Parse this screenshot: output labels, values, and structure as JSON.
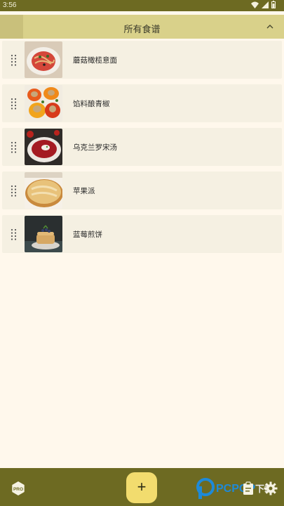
{
  "status": {
    "time": "3:56"
  },
  "header": {
    "title": "所有食谱"
  },
  "recipes": [
    {
      "name": "蘑菇橄榄意面"
    },
    {
      "name": "馅料酿青椒"
    },
    {
      "name": "乌克兰罗宋汤"
    },
    {
      "name": "苹果派"
    },
    {
      "name": "蓝莓煎饼"
    }
  ],
  "bottom": {
    "pro_label": "PRO",
    "add_label": "+"
  },
  "watermark": {
    "brand": "PCPOP",
    "suffix": "下载"
  },
  "colors": {
    "bar": "#6d6a22",
    "header": "#d9d18a",
    "fab": "#f2dc6e",
    "background": "#fff8ec"
  }
}
